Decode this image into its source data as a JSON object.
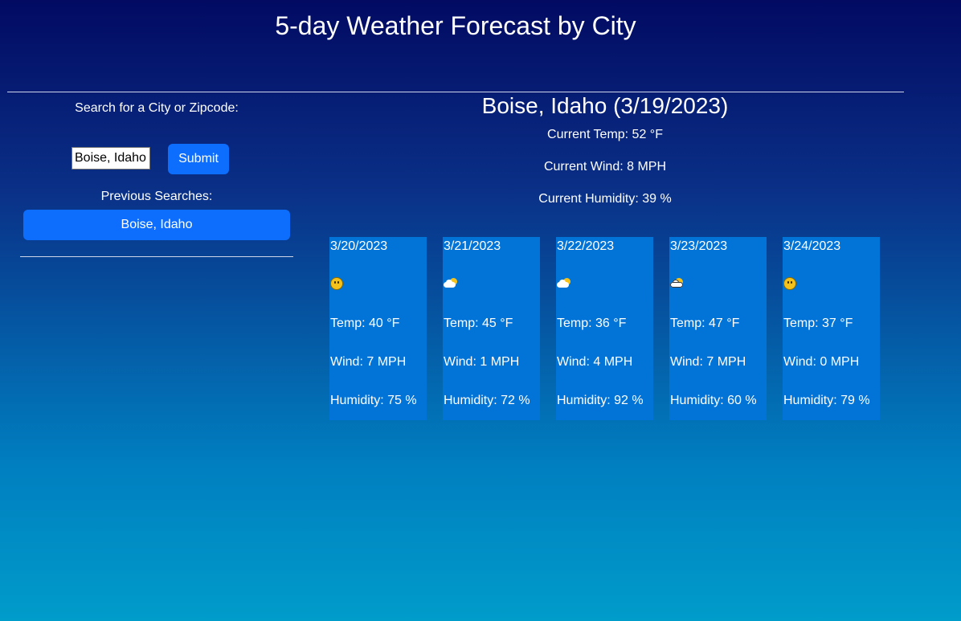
{
  "header": {
    "title": "5-day Weather Forecast by City"
  },
  "search": {
    "label": "Search for a City or Zipcode:",
    "input_value": "Boise, Idaho",
    "submit_label": "Submit"
  },
  "history": {
    "label": "Previous Searches:",
    "items": [
      {
        "label": "Boise, Idaho"
      }
    ]
  },
  "current": {
    "heading": "Boise, Idaho (3/19/2023)",
    "temp": "Current Temp: 52 °F",
    "wind": "Current Wind: 8 MPH",
    "humidity": "Current Humidity: 39 %"
  },
  "forecast": [
    {
      "date": "3/20/2023",
      "icon": "smiling-face-icon",
      "temp": "Temp: 40 °F",
      "wind": "Wind: 7 MPH",
      "humidity": "Humidity: 75 %"
    },
    {
      "date": "3/21/2023",
      "icon": "sun-behind-cloud-icon",
      "temp": "Temp: 45 °F",
      "wind": "Wind: 1 MPH",
      "humidity": "Humidity: 72 %"
    },
    {
      "date": "3/22/2023",
      "icon": "sun-behind-cloud-icon",
      "temp": "Temp: 36 °F",
      "wind": "Wind: 4 MPH",
      "humidity": "Humidity: 92 %"
    },
    {
      "date": "3/23/2023",
      "icon": "sun-behind-large-cloud-icon",
      "temp": "Temp: 47 °F",
      "wind": "Wind: 7 MPH",
      "humidity": "Humidity: 60 %"
    },
    {
      "date": "3/24/2023",
      "icon": "smiling-face-icon",
      "temp": "Temp: 37 °F",
      "wind": "Wind: 0 MPH",
      "humidity": "Humidity: 79 %"
    }
  ],
  "colors": {
    "button": "#0d6efd",
    "card": "#0274d8",
    "gradient_top": "#020a62",
    "gradient_bottom": "#009cca"
  }
}
